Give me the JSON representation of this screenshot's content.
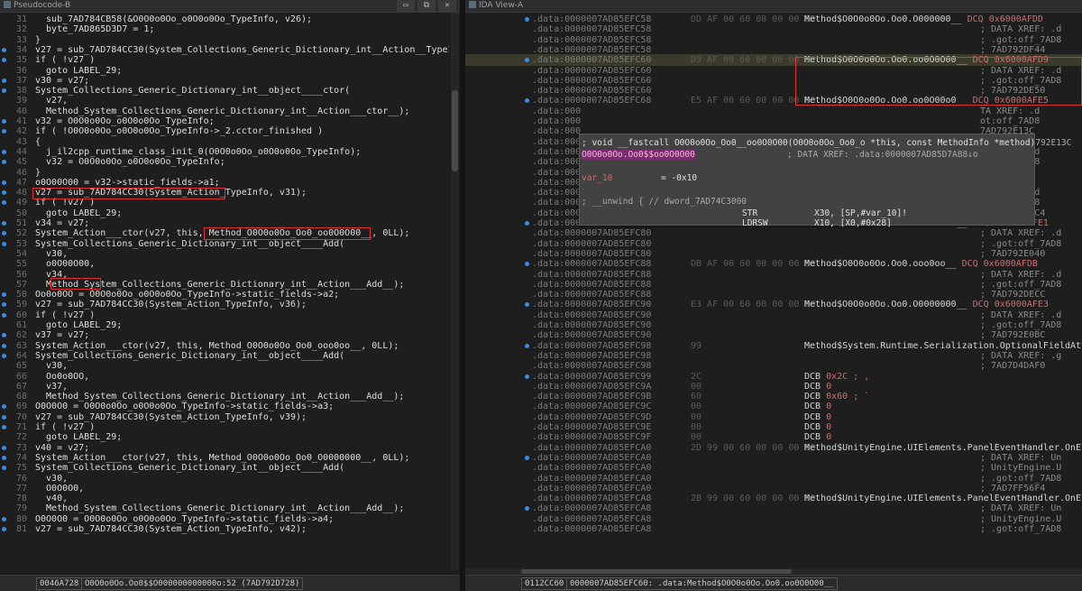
{
  "pseudocode": {
    "tab_title": "Pseudocode-B",
    "window_buttons": [
      "▭",
      "⧉",
      "✕"
    ],
    "lines": [
      {
        "n": "31",
        "t": "  sub_7AD784CB58(&O0O0o0Oo_o0O0o0Oo_TypeInfo, v26);"
      },
      {
        "n": "32",
        "t": "  byte_7AD865D3D7 = 1;"
      },
      {
        "n": "33",
        "t": "}"
      },
      {
        "n": "34",
        "t": "v27 = sub_7AD784CC30(System_Collections_Generic_Dictionary_int__Action__TypeInf"
      },
      {
        "n": "35",
        "t": "if ( !v27 )"
      },
      {
        "n": "36",
        "t": "  goto LABEL_29;"
      },
      {
        "n": "37",
        "t": "v30 = v27;"
      },
      {
        "n": "38",
        "t": "System_Collections_Generic_Dictionary_int__object____ctor("
      },
      {
        "n": "39",
        "t": "  v27,"
      },
      {
        "n": "40",
        "t": "  Method_System_Collections_Generic_Dictionary_int__Action___ctor__);"
      },
      {
        "n": "41",
        "t": "v32 = O0O0o0Oo_o0O0o0Oo_TypeInfo;"
      },
      {
        "n": "42",
        "t": "if ( !O0O0o0Oo_o0O0o0Oo_TypeInfo->_2.cctor_finished )"
      },
      {
        "n": "43",
        "t": "{"
      },
      {
        "n": "44",
        "t": "  j_il2cpp_runtime_class_init_0(O0O0o0Oo_o0O0o0Oo_TypeInfo);"
      },
      {
        "n": "45",
        "t": "  v32 = O0O0o0Oo_o0O0o0Oo_TypeInfo;"
      },
      {
        "n": "46",
        "t": "}"
      },
      {
        "n": "47",
        "t": "o0O00O00 = v32->static_fields->a1;"
      },
      {
        "n": "48",
        "t": "v27 = sub_7AD784CC30(System_Action_TypeInfo, v31);"
      },
      {
        "n": "49",
        "t": "if ( !v27 )"
      },
      {
        "n": "50",
        "t": "  goto LABEL_29;"
      },
      {
        "n": "51",
        "t": "v34 = v27;"
      },
      {
        "n": "52",
        "t": "System_Action___ctor(v27, this, Method_O0O0o0Oo_Oo0_oo0O0O00__, 0LL);"
      },
      {
        "n": "53",
        "t": "System_Collections_Generic_Dictionary_int__object____Add("
      },
      {
        "n": "54",
        "t": "  v30,"
      },
      {
        "n": "55",
        "t": "  o0O00O00,"
      },
      {
        "n": "56",
        "t": "  v34,"
      },
      {
        "n": "57",
        "t": "  Method_System_Collections_Generic_Dictionary_int__Action___Add__);"
      },
      {
        "n": "58",
        "t": "Oo0o0OO = O0O0o0Oo_o0O0o0Oo_TypeInfo->static_fields->a2;"
      },
      {
        "n": "59",
        "t": "v27 = sub_7AD784CC30(System_Action_TypeInfo, v36);"
      },
      {
        "n": "60",
        "t": "if ( !v27 )"
      },
      {
        "n": "61",
        "t": "  goto LABEL_29;"
      },
      {
        "n": "62",
        "t": "v37 = v27;"
      },
      {
        "n": "63",
        "t": "System_Action___ctor(v27, this, Method_O0O0o0Oo_Oo0_ooo0oo__, 0LL);"
      },
      {
        "n": "64",
        "t": "System_Collections_Generic_Dictionary_int__object____Add("
      },
      {
        "n": "65",
        "t": "  v30,"
      },
      {
        "n": "66",
        "t": "  Oo0o0OO,"
      },
      {
        "n": "67",
        "t": "  v37,"
      },
      {
        "n": "68",
        "t": "  Method_System_Collections_Generic_Dictionary_int__Action___Add__);"
      },
      {
        "n": "69",
        "t": "O0O0O0 = O0O0o0Oo_o0O0o0Oo_TypeInfo->static_fields->a3;"
      },
      {
        "n": "70",
        "t": "v27 = sub_7AD784CC30(System_Action_TypeInfo, v39);"
      },
      {
        "n": "71",
        "t": "if ( !v27 )"
      },
      {
        "n": "72",
        "t": "  goto LABEL_29;"
      },
      {
        "n": "73",
        "t": "v40 = v27;"
      },
      {
        "n": "74",
        "t": "System_Action___ctor(v27, this, Method_O0O0o0Oo_Oo0_O0000000__, 0LL);"
      },
      {
        "n": "75",
        "t": "System_Collections_Generic_Dictionary_int__object____Add("
      },
      {
        "n": "76",
        "t": "  v30,"
      },
      {
        "n": "77",
        "t": "  O0O0O0,"
      },
      {
        "n": "78",
        "t": "  v40,"
      },
      {
        "n": "79",
        "t": "  Method_System_Collections_Generic_Dictionary_int__Action___Add__);"
      },
      {
        "n": "80",
        "t": "O0O0O0 = O0O0o0Oo_o0O0o0Oo_TypeInfo->static_fields->a4;"
      },
      {
        "n": "81",
        "t": "v27 = sub_7AD784CC30(System_Action_TypeInfo, v42);"
      }
    ],
    "status": {
      "offset": "0046A728",
      "location": "O0O0o0Oo.Oo0$$O000000000000o:52 (7AD792D728)"
    }
  },
  "ida_view": {
    "tab_title": "IDA View-A",
    "lines": [
      {
        "a": ".data:0000007AD85EFC58",
        "b": "DD AF 00 60 00 00 00 00",
        "i": "Method$O0O0o0Oo.Oo0.O000000__",
        "op": "DCQ 0x6000AFDD",
        "c": ""
      },
      {
        "a": ".data:0000007AD85EFC58",
        "b": "",
        "i": "",
        "op": "",
        "c": "; DATA XREF: .d"
      },
      {
        "a": ".data:0000007AD85EFC58",
        "b": "",
        "i": "",
        "op": "",
        "c": "; .got:off_7AD8"
      },
      {
        "a": ".data:0000007AD85EFC58",
        "b": "",
        "i": "",
        "op": "",
        "c": "; 7AD792DF44"
      },
      {
        "a": ".data:0000007AD85EFC60",
        "b": "D9 AF 00 60 00 00 00 00",
        "i": "Method$O0O0o0Oo.Oo0.oo0O0O00__",
        "op": "DCQ 0x6000AFD9",
        "c": "",
        "cur": true
      },
      {
        "a": ".data:0000007AD85EFC60",
        "b": "",
        "i": "",
        "op": "",
        "c": "; DATA XREF: .d"
      },
      {
        "a": ".data:0000007AD85EFC60",
        "b": "",
        "i": "",
        "op": "",
        "c": "; .got:off_7AD8"
      },
      {
        "a": ".data:0000007AD85EFC60",
        "b": "",
        "i": "",
        "op": "",
        "c": "; 7AD792DE50"
      },
      {
        "a": ".data:0000007AD85EFC68",
        "b": "E5 AF 00 60 00 00 00 00",
        "i": "Method$O0O0o0Oo.Oo0.oo0O00o0__",
        "op": "DCQ 0x6000AFE5",
        "c": ""
      },
      {
        "a": ".data:000",
        "b": "",
        "i": "",
        "op": "",
        "c": "TA XREF: .d"
      },
      {
        "a": ".data:000",
        "b": "",
        "i": "",
        "op": "",
        "c": "ot:off_7AD8"
      },
      {
        "a": ".data:000",
        "b": "",
        "i": "",
        "op": "",
        "c": "7AD792E13C"
      },
      {
        "a": ".data:000",
        "b": "",
        "i": "",
        "op": "",
        "c": ""
      },
      {
        "a": ".data:000",
        "b": "",
        "i": "",
        "op": "",
        "c": "TA XREF: .d"
      },
      {
        "a": ".data:000",
        "b": "",
        "i": "",
        "op": "",
        "c": "ot:off_7AD8"
      },
      {
        "a": ".data:000",
        "b": "",
        "i": "",
        "op": "",
        "c": "AD792E1C4"
      },
      {
        "a": ".data:000",
        "b": "",
        "i": "",
        "op": "",
        "c": ""
      },
      {
        "a": ".data:000",
        "b": "",
        "i": "",
        "op": "",
        "c": "TA XREF: .d"
      },
      {
        "a": ".data:000",
        "b": "",
        "i": "",
        "op": "",
        "c": "ot:off_7AD8"
      },
      {
        "a": ".data:0000007AD85EFC78",
        "b": "",
        "i": "",
        "op": "",
        "c": "; 7AD792DFC4"
      },
      {
        "a": ".data:0000007AD85EFC80",
        "b": "E1 AF 00 60 00 00 00 00",
        "i": "Method$O0O0o0Oo.Oo0.oo0O00o0__",
        "op": "DCQ 0x6000AFE1",
        "c": ""
      },
      {
        "a": ".data:0000007AD85EFC80",
        "b": "",
        "i": "",
        "op": "",
        "c": "; DATA XREF: .d"
      },
      {
        "a": ".data:0000007AD85EFC80",
        "b": "",
        "i": "",
        "op": "",
        "c": "; .got:off_7AD8"
      },
      {
        "a": ".data:0000007AD85EFC80",
        "b": "",
        "i": "",
        "op": "",
        "c": "; 7AD792E040"
      },
      {
        "a": ".data:0000007AD85EFC88",
        "b": "DB AF 00 60 00 00 00 00",
        "i": "Method$O0O0o0Oo.Oo0.ooo0oo__",
        "op": "DCQ 0x6000AFDB",
        "c": ""
      },
      {
        "a": ".data:0000007AD85EFC88",
        "b": "",
        "i": "",
        "op": "",
        "c": "; DATA XREF: .d"
      },
      {
        "a": ".data:0000007AD85EFC88",
        "b": "",
        "i": "",
        "op": "",
        "c": "; .got:off_7AD8"
      },
      {
        "a": ".data:0000007AD85EFC88",
        "b": "",
        "i": "",
        "op": "",
        "c": "; 7AD792DECC"
      },
      {
        "a": ".data:0000007AD85EFC90",
        "b": "E3 AF 00 60 00 00 00 00",
        "i": "Method$O0O0o0Oo.Oo0.O0000000__",
        "op": "DCQ 0x6000AFE3",
        "c": ""
      },
      {
        "a": ".data:0000007AD85EFC90",
        "b": "",
        "i": "",
        "op": "",
        "c": "; DATA XREF: .d"
      },
      {
        "a": ".data:0000007AD85EFC90",
        "b": "",
        "i": "",
        "op": "",
        "c": "; .got:off_7AD8"
      },
      {
        "a": ".data:0000007AD85EFC90",
        "b": "",
        "i": "",
        "op": "",
        "c": "; 7AD792E0BC"
      },
      {
        "a": ".data:0000007AD85EFC98",
        "b": "99",
        "i": "Method$System.Runtime.Serialization.OptionalFieldAttrib",
        "op": "",
        "c": ""
      },
      {
        "a": ".data:0000007AD85EFC98",
        "b": "",
        "i": "",
        "op": "",
        "c": "; DATA XREF: .g"
      },
      {
        "a": ".data:0000007AD85EFC98",
        "b": "",
        "i": "",
        "op": "",
        "c": "; 7AD7D4DAF0"
      },
      {
        "a": ".data:0000007AD85EFC99",
        "b": "2C",
        "i": "DCB",
        "op": "0x2C ; ,",
        "c": ""
      },
      {
        "a": ".data:0000007AD85EFC9A",
        "b": "00",
        "i": "DCB",
        "op": "0",
        "c": ""
      },
      {
        "a": ".data:0000007AD85EFC9B",
        "b": "60",
        "i": "DCB",
        "op": "0x60 ; `",
        "c": ""
      },
      {
        "a": ".data:0000007AD85EFC9C",
        "b": "00",
        "i": "DCB",
        "op": "0",
        "c": ""
      },
      {
        "a": ".data:0000007AD85EFC9D",
        "b": "00",
        "i": "DCB",
        "op": "0",
        "c": ""
      },
      {
        "a": ".data:0000007AD85EFC9E",
        "b": "00",
        "i": "DCB",
        "op": "0",
        "c": ""
      },
      {
        "a": ".data:0000007AD85EFC9F",
        "b": "00",
        "i": "DCB",
        "op": "0",
        "c": ""
      },
      {
        "a": ".data:0000007AD85EFCA0",
        "b": "2D 99 00 60 00 00 00 00",
        "i": "Method$UnityEngine.UIElements.PanelEventHandler.OnEleme",
        "op": "",
        "c": ""
      },
      {
        "a": ".data:0000007AD85EFCA0",
        "b": "",
        "i": "",
        "op": "",
        "c": "; DATA XREF: Un"
      },
      {
        "a": ".data:0000007AD85EFCA0",
        "b": "",
        "i": "",
        "op": "",
        "c": "; UnityEngine.U"
      },
      {
        "a": ".data:0000007AD85EFCA0",
        "b": "",
        "i": "",
        "op": "",
        "c": "; .got:off_7AD8"
      },
      {
        "a": ".data:0000007AD85EFCA0",
        "b": "",
        "i": "",
        "op": "",
        "c": "; 7AD7FF56F4"
      },
      {
        "a": ".data:0000007AD85EFCA8",
        "b": "2B 99 00 60 00 00 00 00",
        "i": "Method$UnityEngine.UIElements.PanelEventHandler.OnEleme",
        "op": "",
        "c": ""
      },
      {
        "a": ".data:0000007AD85EFCA8",
        "b": "",
        "i": "",
        "op": "",
        "c": "; DATA XREF: Un"
      },
      {
        "a": ".data:0000007AD85EFCA8",
        "b": "",
        "i": "",
        "op": "",
        "c": "; UnityEngine.U"
      },
      {
        "a": ".data:0000007AD85EFCA8",
        "b": "",
        "i": "",
        "op": "",
        "c": "; .got:off_7AD8"
      }
    ],
    "hint": {
      "sig": "; void __fastcall O0O0o0Oo_Oo0__oo0O0O00(O0O0o0Oo_Oo0_o *this, const MethodInfo *method)",
      "sig_tail": "792E13C",
      "name": "O0O0o0Oo.Oo0$$oo0O0O00",
      "xref": "; DATA XREF: .data:0000007AD85D7A88↓o",
      "var": "var_10",
      "var_val": "= -0x10",
      "unwind": "; __unwind { // dword_7AD74C3000",
      "ins1": "STR",
      "ops1": "X30, [SP,#var_10]!",
      "ins2": "LDRSW",
      "ops2": "X10, [X0,#0x28]"
    },
    "status": {
      "offset": "0112CC60",
      "location": "0000007AD85EFC60: .data:Method$O0O0o0Oo.Oo0.oo0O0O00__"
    }
  }
}
